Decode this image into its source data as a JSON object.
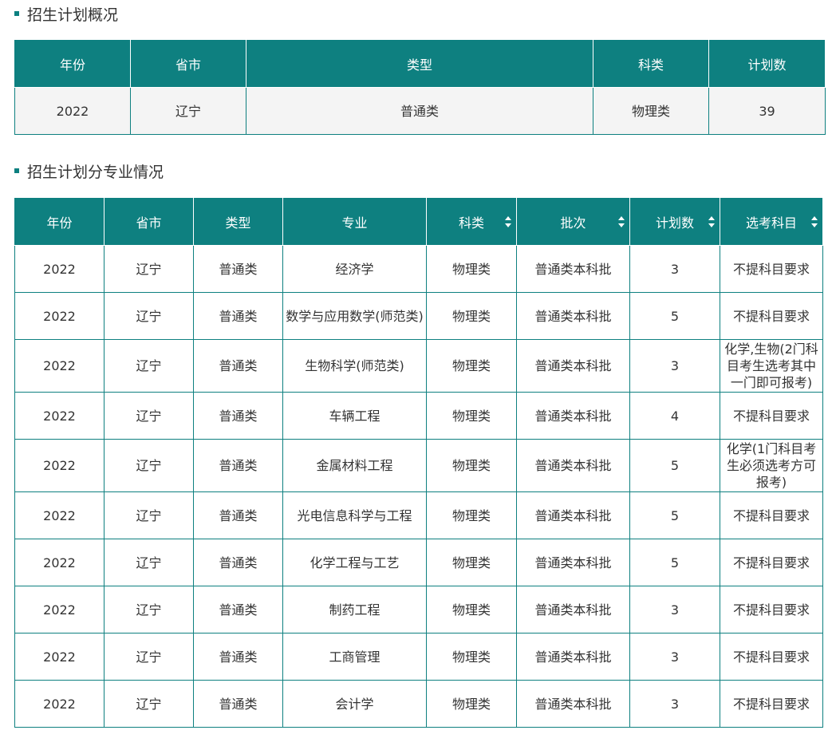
{
  "overview": {
    "title": "招生计划概况",
    "headers": [
      "年份",
      "省市",
      "类型",
      "科类",
      "计划数"
    ],
    "row": [
      "2022",
      "辽宁",
      "普通类",
      "物理类",
      "39"
    ]
  },
  "majors": {
    "title": "招生计划分专业情况",
    "headers": [
      "年份",
      "省市",
      "类型",
      "专业",
      "科类",
      "批次",
      "计划数",
      "选考科目"
    ],
    "rows": [
      [
        "2022",
        "辽宁",
        "普通类",
        "经济学",
        "物理类",
        "普通类本科批",
        "3",
        "不提科目要求"
      ],
      [
        "2022",
        "辽宁",
        "普通类",
        "数学与应用数学(师范类)",
        "物理类",
        "普通类本科批",
        "5",
        "不提科目要求"
      ],
      [
        "2022",
        "辽宁",
        "普通类",
        "生物科学(师范类)",
        "物理类",
        "普通类本科批",
        "3",
        "化学,生物(2门科目考生选考其中一门即可报考)"
      ],
      [
        "2022",
        "辽宁",
        "普通类",
        "车辆工程",
        "物理类",
        "普通类本科批",
        "4",
        "不提科目要求"
      ],
      [
        "2022",
        "辽宁",
        "普通类",
        "金属材料工程",
        "物理类",
        "普通类本科批",
        "5",
        "化学(1门科目考生必须选考方可报考)"
      ],
      [
        "2022",
        "辽宁",
        "普通类",
        "光电信息科学与工程",
        "物理类",
        "普通类本科批",
        "5",
        "不提科目要求"
      ],
      [
        "2022",
        "辽宁",
        "普通类",
        "化学工程与工艺",
        "物理类",
        "普通类本科批",
        "5",
        "不提科目要求"
      ],
      [
        "2022",
        "辽宁",
        "普通类",
        "制药工程",
        "物理类",
        "普通类本科批",
        "3",
        "不提科目要求"
      ],
      [
        "2022",
        "辽宁",
        "普通类",
        "工商管理",
        "物理类",
        "普通类本科批",
        "3",
        "不提科目要求"
      ],
      [
        "2022",
        "辽宁",
        "普通类",
        "会计学",
        "物理类",
        "普通类本科批",
        "3",
        "不提科目要求"
      ]
    ]
  },
  "colors": {
    "header_bg": "#0e8080",
    "row_bg": "#f4f4f4",
    "accent": "#0c8080"
  },
  "icons": {
    "sort": "sort-icon"
  }
}
